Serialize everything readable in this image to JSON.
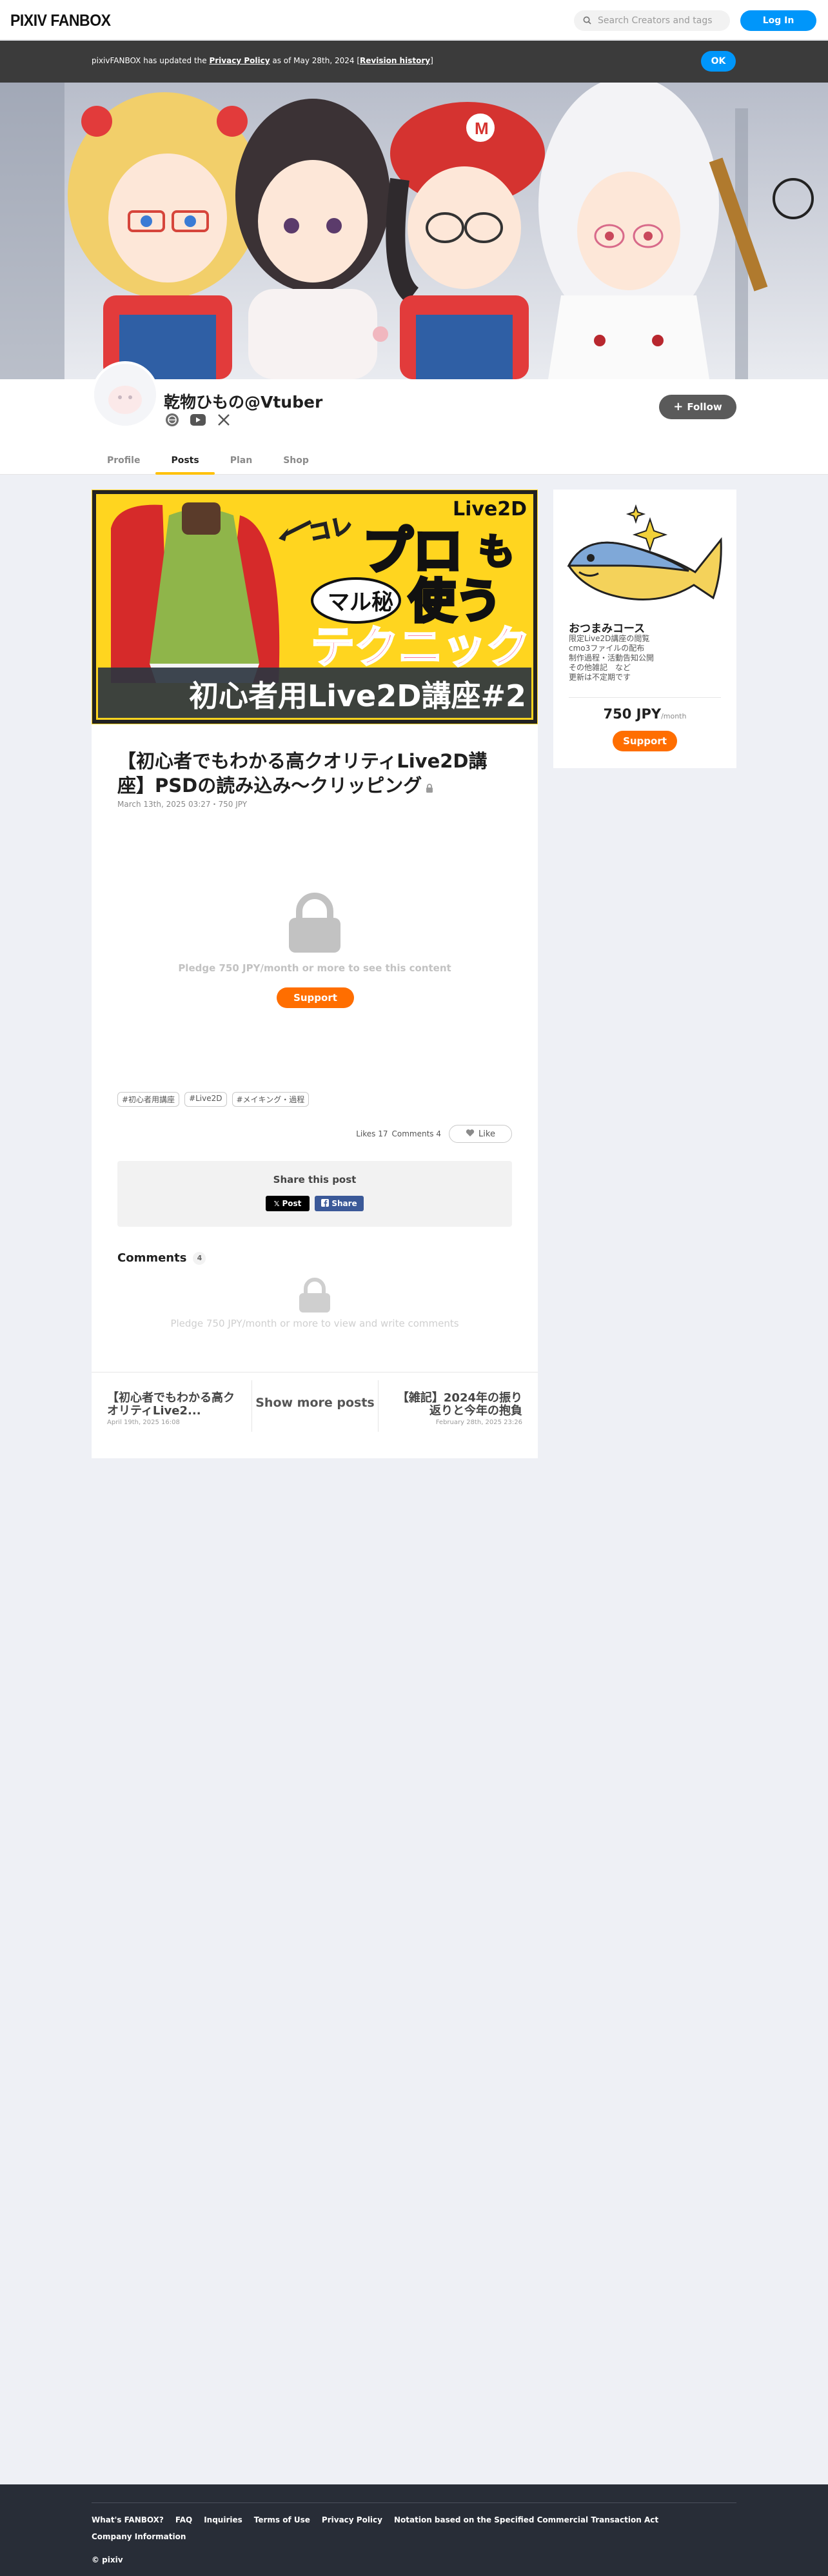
{
  "header": {
    "logo": "PIXIV FANBOX",
    "search_placeholder": "Search Creators and tags",
    "login_label": "Log In"
  },
  "notice": {
    "prefix": "pixivFANBOX has updated the ",
    "policy_link": "Privacy Policy",
    "middle": " as of May 28th, 2024 [",
    "history_link": "Revision history",
    "suffix": "]",
    "ok_label": "OK"
  },
  "creator": {
    "name": "乾物ひもの@Vtuber",
    "follow_label": "Follow"
  },
  "tabs": [
    "Profile",
    "Posts",
    "Plan",
    "Shop"
  ],
  "post": {
    "thumbnail_text": {
      "top_right": "Live2D",
      "arrow_word": "コレ",
      "pro": "プロ",
      "mo": "も",
      "secret": "マル秘",
      "use": "使う",
      "technique": "テクニック",
      "banner": "初心者用Live2D講座#2"
    },
    "title": "【初心者でもわかる高クオリティLive2D講座】PSDの読み込み～クリッピング",
    "meta": "March 13th, 2025 03:27・750 JPY",
    "pledge_text": "Pledge 750 JPY/month or more to see this content",
    "support_label": "Support",
    "tags": [
      "#初心者用講座",
      "#Live2D",
      "#メイキング・過程"
    ],
    "likes": "Likes 17",
    "comments_stat": "Comments 4",
    "like_label": "Like",
    "share_title": "Share this post",
    "share_x": "Post",
    "share_fb": "Share",
    "comments_heading": "Comments",
    "comments_count": "4",
    "comments_locked": "Pledge 750 JPY/month or more to view and write comments",
    "prev": {
      "title": "【初心者でもわかる高クオリティLive2...",
      "date": "April 19th, 2025 16:08"
    },
    "show_more": "Show more posts",
    "next": {
      "title": "【雑記】2024年の振り返りと今年の抱負",
      "date": "February 28th, 2025 23:26"
    }
  },
  "plan": {
    "name": "おつまみコース",
    "desc": [
      "限定Live2D講座の閲覧",
      "cmo3ファイルの配布",
      "制作過程・活動告知公開",
      "その他雑記　など",
      "更新は不定期です"
    ],
    "price": "750 JPY",
    "per": "/month",
    "support_label": "Support"
  },
  "footer": {
    "links": [
      "What's FANBOX?",
      "FAQ",
      "Inquiries",
      "Terms of Use",
      "Privacy Policy",
      "Notation based on the Specified Commercial Transaction Act",
      "Company Information"
    ],
    "copyright": "© pixiv"
  },
  "colors": {
    "accent_blue": "#0096fa",
    "support_orange": "#ff6e00",
    "tab_underline": "#ffc107",
    "page_bg": "#eef0f5"
  }
}
